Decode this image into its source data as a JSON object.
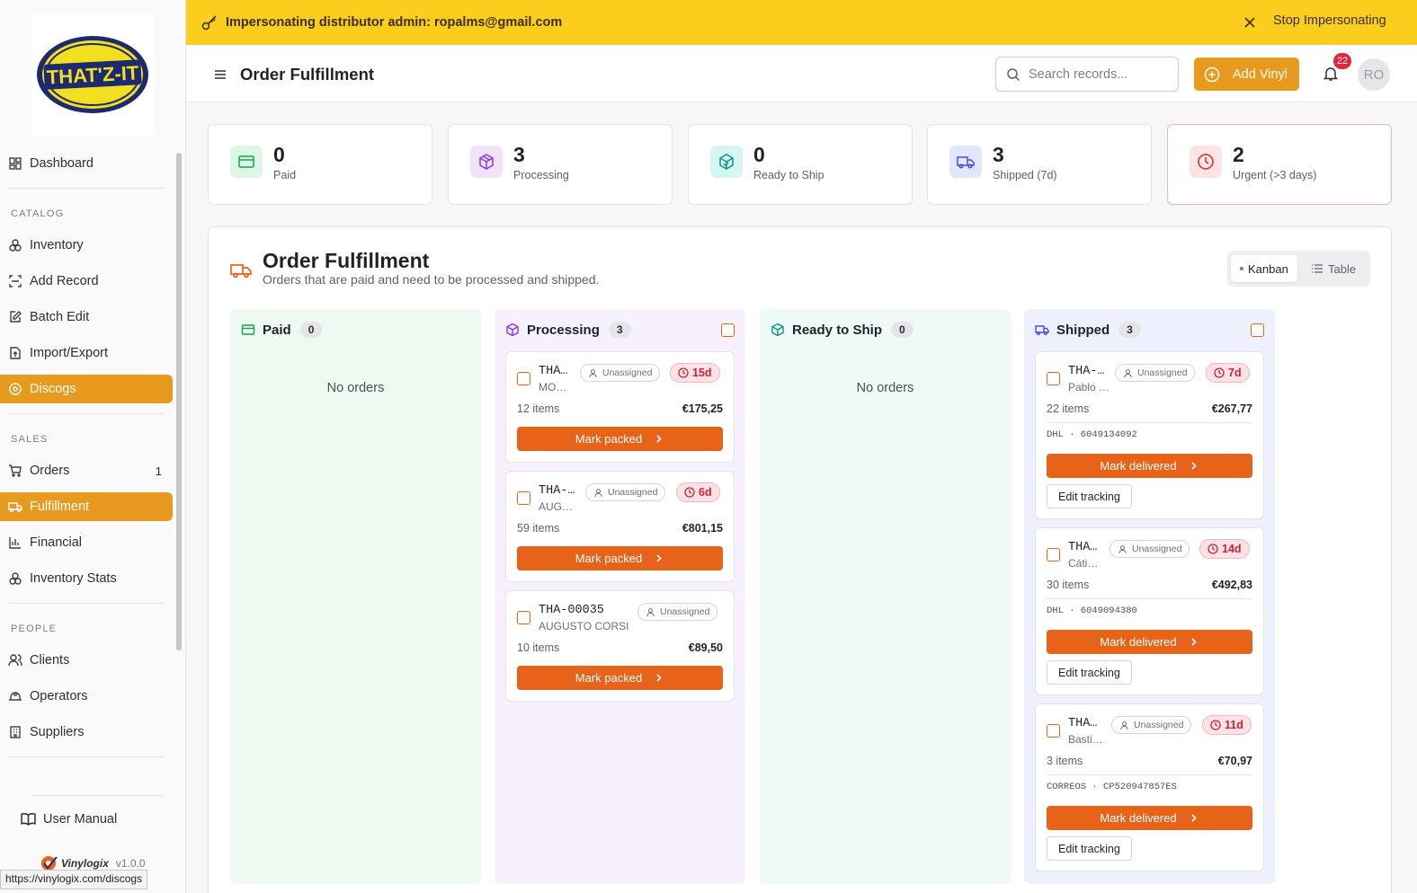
{
  "banner": {
    "text": "Impersonating distributor admin: ropalms@gmail.com",
    "stop_label": "Stop Impersonating"
  },
  "header": {
    "title": "Order Fulfillment",
    "search_placeholder": "Search records...",
    "add_label": "Add Vinyl",
    "notif_count": "22",
    "avatar_initials": "RO"
  },
  "sidebar": {
    "logo_text": "THAT'Z-IT",
    "dashboard": "Dashboard",
    "catalog_title": "CATALOG",
    "catalog": [
      "Inventory",
      "Add Record",
      "Batch Edit",
      "Import/Export",
      "Discogs"
    ],
    "sales_title": "SALES",
    "sales": [
      "Orders",
      "Fulfillment",
      "Financial",
      "Inventory Stats"
    ],
    "orders_count": "1",
    "people_title": "PEOPLE",
    "people": [
      "Clients",
      "Operators",
      "Suppliers"
    ],
    "manual": "User Manual",
    "brand": "Vinylogix",
    "version": "v1.0.0",
    "status_url": "https://vinylogix.com/discogs"
  },
  "stats": [
    {
      "value": "0",
      "label": "Paid"
    },
    {
      "value": "3",
      "label": "Processing"
    },
    {
      "value": "0",
      "label": "Ready to Ship"
    },
    {
      "value": "3",
      "label": "Shipped (7d)"
    },
    {
      "value": "2",
      "label": "Urgent (>3 days)"
    }
  ],
  "panel": {
    "title": "Order Fulfillment",
    "subtitle": "Orders that are paid and need to be processed and shipped.",
    "view_kanban": "Kanban",
    "view_table": "Table"
  },
  "columns": {
    "paid": {
      "title": "Paid",
      "count": "0",
      "empty": "No orders"
    },
    "processing": {
      "title": "Processing",
      "count": "3",
      "cards": [
        {
          "id": "THA…",
          "customer": "MO…",
          "assignee": "Unassigned",
          "age": "15d",
          "items": "12 items",
          "total": "€175,25",
          "action": "Mark packed"
        },
        {
          "id": "THA-…",
          "customer": "AUG…",
          "assignee": "Unassigned",
          "age": "6d",
          "items": "59 items",
          "total": "€801,15",
          "action": "Mark packed"
        },
        {
          "id": "THA-00035",
          "customer": "AUGUSTO CORSI",
          "assignee": "Unassigned",
          "items": "10 items",
          "total": "€89,50",
          "action": "Mark packed"
        }
      ]
    },
    "ready": {
      "title": "Ready to Ship",
      "count": "0",
      "empty": "No orders"
    },
    "shipped": {
      "title": "Shipped",
      "count": "3",
      "cards": [
        {
          "id": "THA-…",
          "customer": "Pablo …",
          "assignee": "Unassigned",
          "age": "7d",
          "items": "22 items",
          "total": "€267,77",
          "tracking": "DHL · 6049134092",
          "action": "Mark delivered",
          "edit": "Edit tracking"
        },
        {
          "id": "THA…",
          "customer": "Cáti…",
          "assignee": "Unassigned",
          "age": "14d",
          "items": "30 items",
          "total": "€492,83",
          "tracking": "DHL · 6049094380",
          "action": "Mark delivered",
          "edit": "Edit tracking"
        },
        {
          "id": "THA…",
          "customer": "Basti…",
          "assignee": "Unassigned",
          "age": "11d",
          "items": "3 items",
          "total": "€70,97",
          "tracking": "CORREOS · CP520947857ES",
          "action": "Mark delivered",
          "edit": "Edit tracking"
        }
      ]
    }
  }
}
